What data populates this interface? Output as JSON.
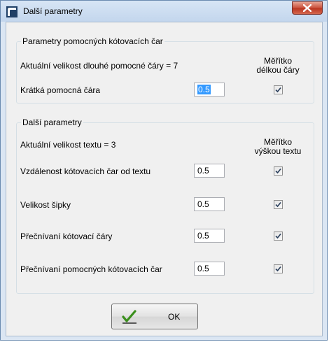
{
  "window": {
    "title": "Další parametry"
  },
  "group_auxiliary": {
    "legend": "Parametry pomocných kótovacích čar",
    "long_line_info": "Aktuální velikost dlouhé pomocné čáry = 7",
    "scale_header_line1": "Měřítko",
    "scale_header_line2": "délkou čáry",
    "short_line_label": "Krátká pomocná čára",
    "short_line_value": "0.5",
    "short_line_checked": true
  },
  "group_other": {
    "legend": "Další parametry",
    "text_size_info": "Aktuální velikost textu = 3",
    "scale_header_line1": "Měřítko",
    "scale_header_line2": "výškou textu",
    "rows": [
      {
        "label": "Vzdálenost kótovacích čar od textu",
        "value": "0.5",
        "checked": true
      },
      {
        "label": "Velikost šipky",
        "value": "0.5",
        "checked": true
      },
      {
        "label": "Přečnívaní kótovací čáry",
        "value": "0.5",
        "checked": true
      },
      {
        "label": "Přečnívaní pomocných kótovacích čar",
        "value": "0.5",
        "checked": true
      }
    ]
  },
  "ok_button": {
    "label": "OK",
    "icon": "check-icon",
    "icon_color": "#3a8f1c"
  },
  "colors": {
    "title_bar": "#c3d6ed",
    "close_button": "#c9503b",
    "selection": "#3399ff"
  }
}
